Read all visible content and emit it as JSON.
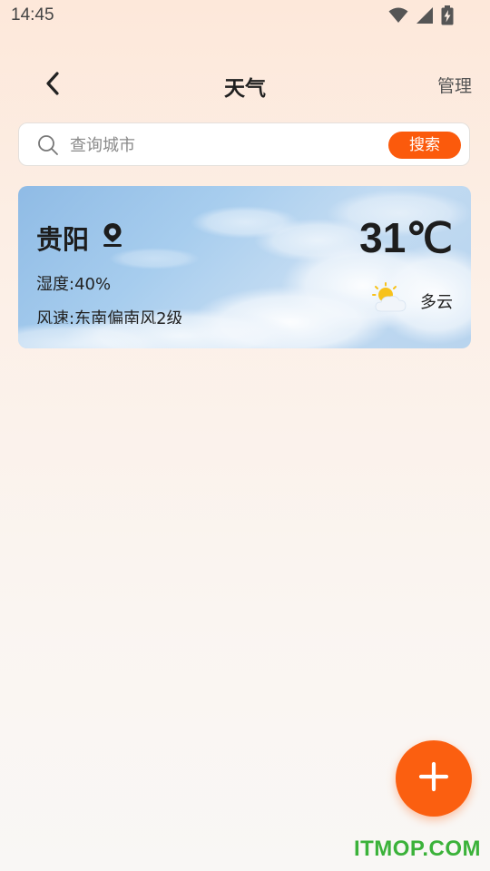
{
  "status_bar": {
    "time": "14:45",
    "icons": [
      "wifi-icon",
      "signal-icon",
      "battery-charging-icon"
    ]
  },
  "header": {
    "back_icon": "chevron-left-icon",
    "title": "天气",
    "manage_label": "管理"
  },
  "search": {
    "icon": "search-icon",
    "placeholder": "查询城市",
    "value": "",
    "button_label": "搜索"
  },
  "weather_card": {
    "city": "贵阳",
    "location_icon": "location-pin-icon",
    "temperature": "31℃",
    "humidity": "湿度:40%",
    "wind": "风速:东南偏南风2级",
    "condition": "多云",
    "condition_icon": "partly-cloudy-icon"
  },
  "fab": {
    "icon": "plus-icon"
  },
  "watermark": {
    "text": "ITMOP.COM"
  },
  "colors": {
    "accent": "#fb5a0c",
    "watermark": "#3bb23a"
  }
}
